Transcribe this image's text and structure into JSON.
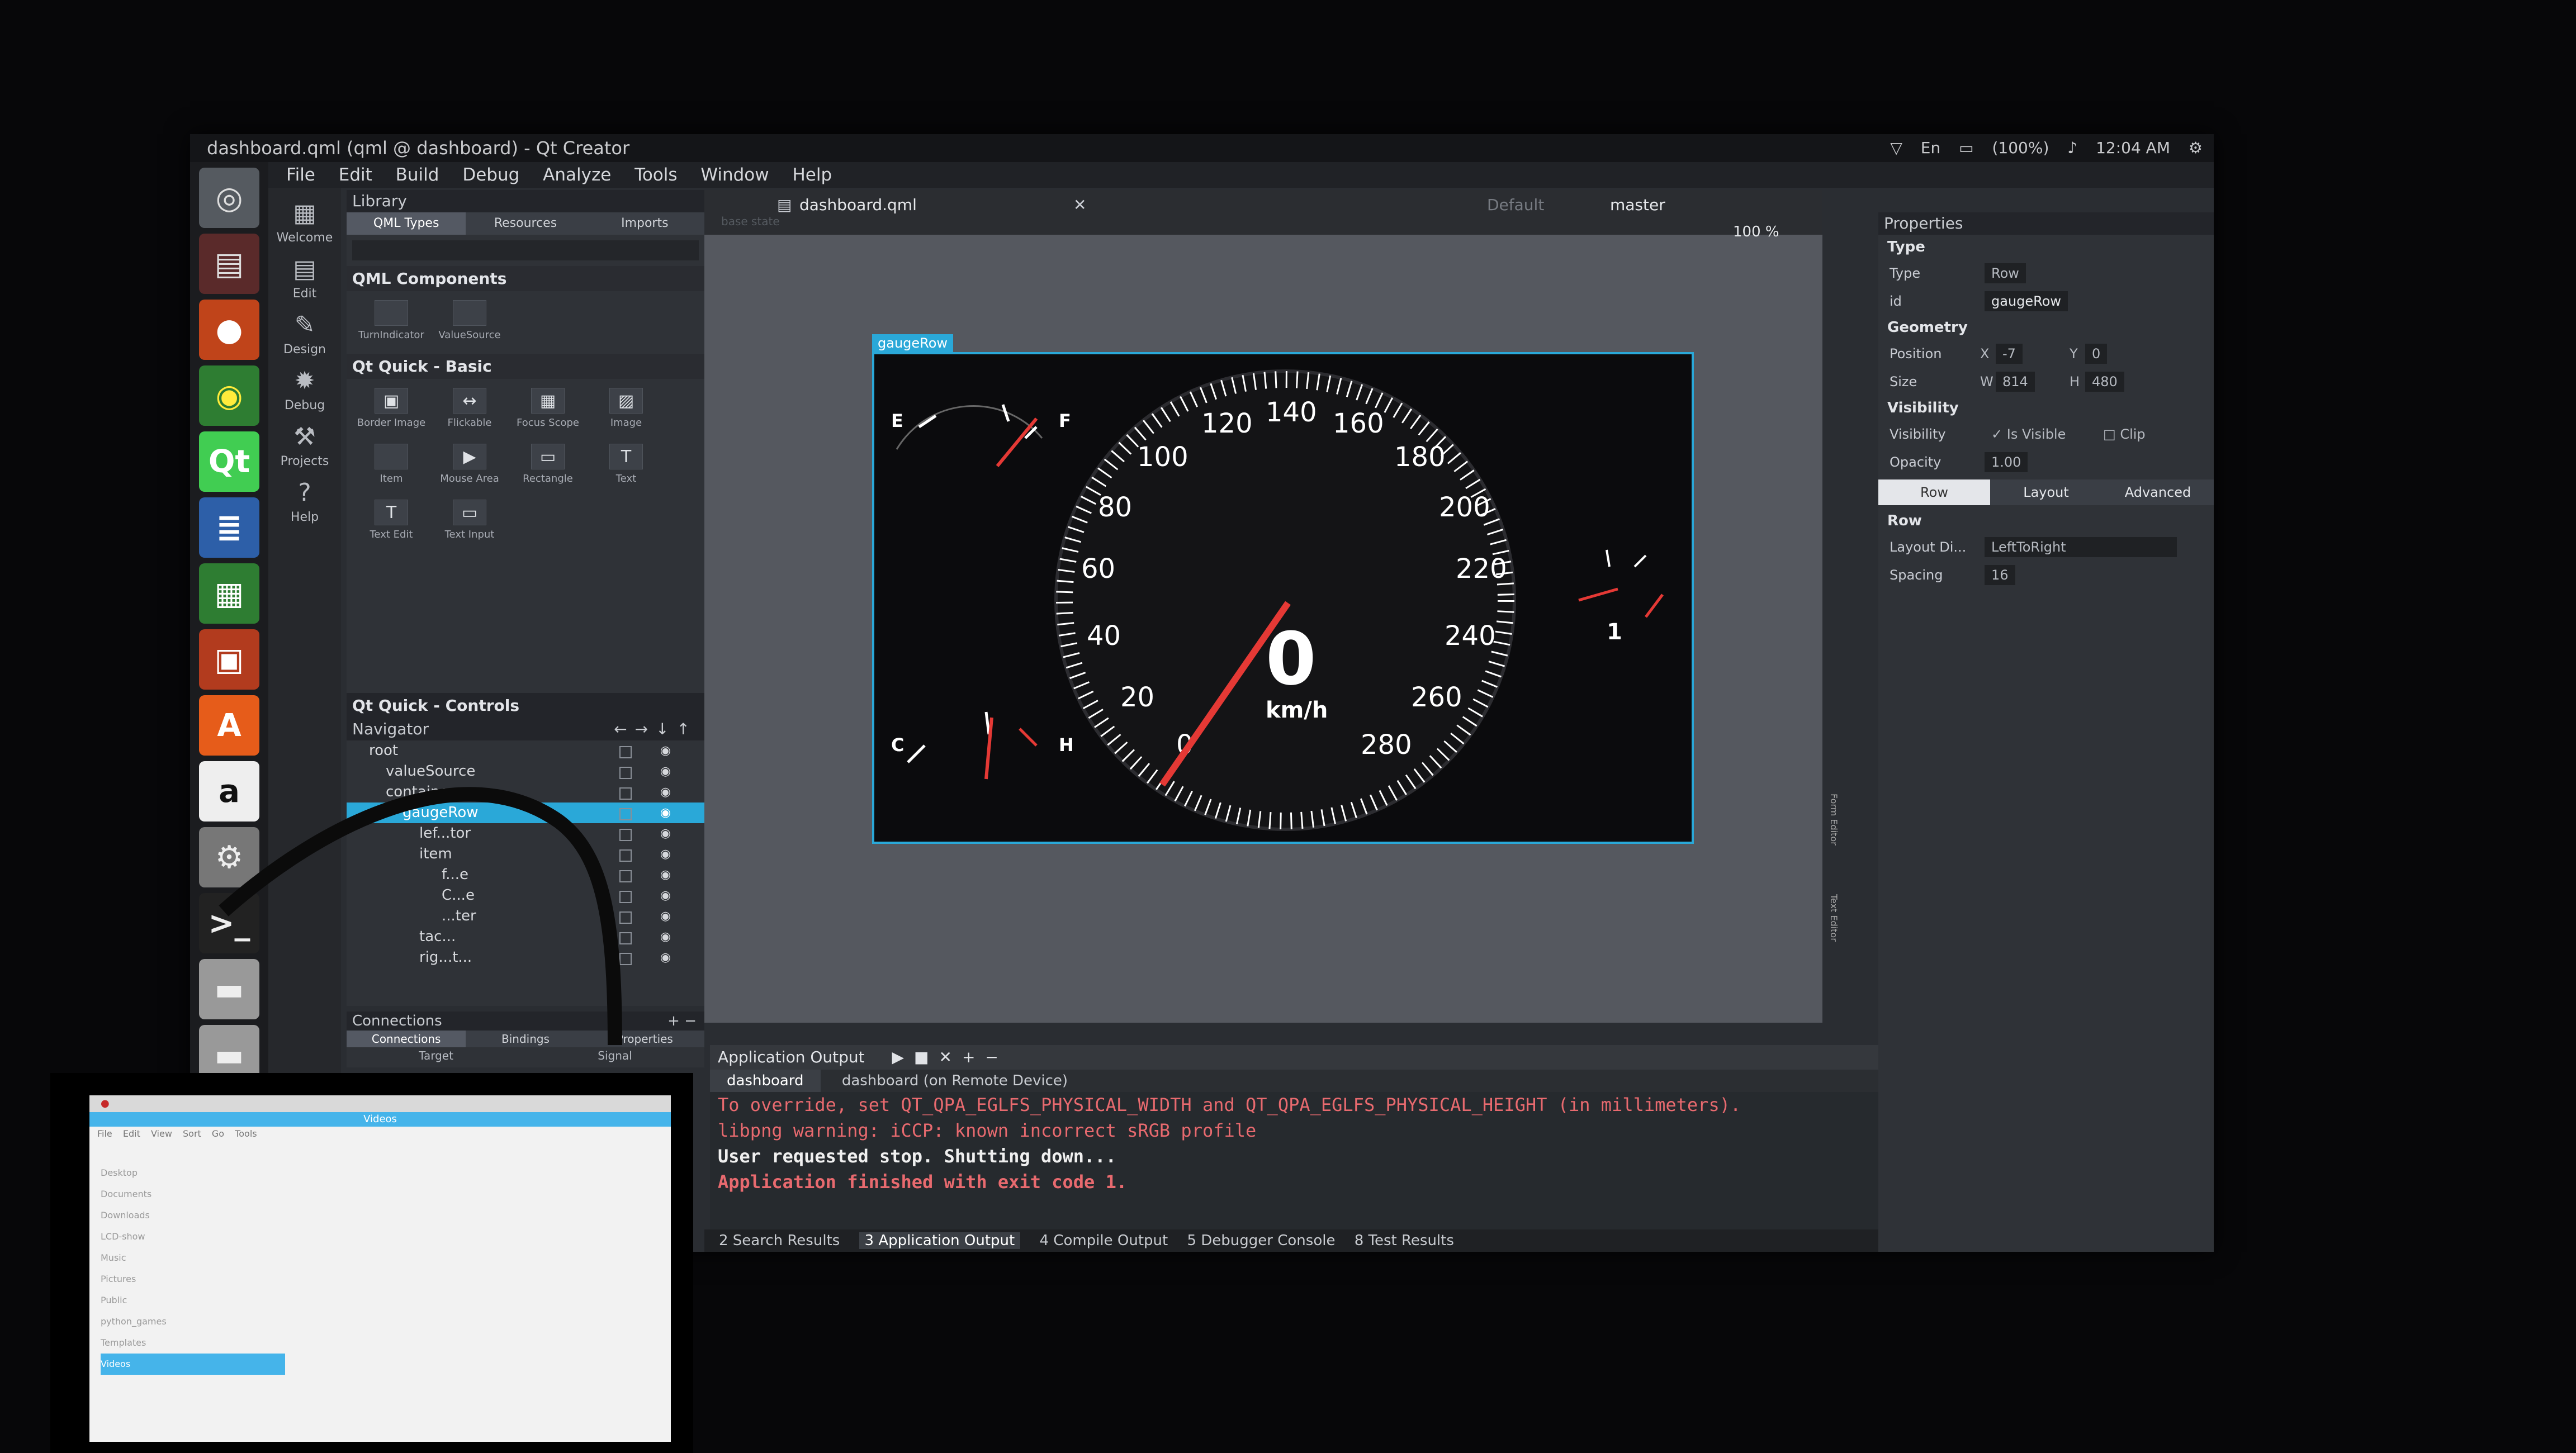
{
  "window": {
    "title": "dashboard.qml (qml @ dashboard) - Qt Creator",
    "status": {
      "keyboard": "En",
      "battery": "(100%)",
      "time": "12:04 AM"
    }
  },
  "menu": [
    "File",
    "Edit",
    "Build",
    "Debug",
    "Analyze",
    "Tools",
    "Window",
    "Help"
  ],
  "modes": [
    "Welcome",
    "Edit",
    "Design",
    "Debug",
    "Projects",
    "Help"
  ],
  "library": {
    "title": "Library",
    "tabs": [
      "QML Types",
      "Resources",
      "Imports"
    ],
    "sections": {
      "qml_components": "QML Components",
      "qml_components_items": [
        "TurnIndicator",
        "ValueSource"
      ],
      "qt_quick_basic": "Qt Quick - Basic",
      "qt_quick_basic_items": [
        "Border Image",
        "Flickable",
        "Focus Scope",
        "Image",
        "Item",
        "Mouse Area",
        "Rectangle",
        "Text",
        "Text Edit",
        "Text Input"
      ],
      "qt_quick_controls": "Qt Quick - Controls"
    }
  },
  "navigator": {
    "title": "Navigator",
    "rows": [
      "root",
      "valueSource",
      "container",
      "gaugeRow",
      "lef...tor",
      "item",
      "f...e",
      "C...e",
      "...ter",
      "tac...",
      "rig...t..."
    ]
  },
  "connections": {
    "title": "Connections",
    "tabs": [
      "Connections",
      "Bindings",
      "Properties"
    ],
    "columns": [
      "Target",
      "Signal"
    ]
  },
  "editor": {
    "file": "dashboard.qml",
    "default_state": "Default",
    "branch": "master",
    "zoom": "100 %",
    "state_button": "base state"
  },
  "dashboard": {
    "selection_label": "gaugeRow",
    "speed_value": "0",
    "speed_unit": "km/h",
    "speed_ticks": [
      "0",
      "20",
      "40",
      "60",
      "80",
      "100",
      "120",
      "140",
      "160",
      "180",
      "200",
      "220",
      "240",
      "260",
      "280"
    ],
    "fuel_labels": [
      "E",
      "F"
    ],
    "temp_labels": [
      "C",
      "H"
    ],
    "tacho_value": "1"
  },
  "side_labels": [
    "Form Editor",
    "Text Editor"
  ],
  "output": {
    "title": "Application Output",
    "tabs": [
      "dashboard",
      "dashboard (on Remote Device)"
    ],
    "lines": [
      "To override, set QT_QPA_EGLFS_PHYSICAL_WIDTH and QT_QPA_EGLFS_PHYSICAL_HEIGHT (in millimeters).",
      "libpng warning: iCCP: known incorrect sRGB profile",
      "User requested stop. Shutting down...",
      "Application finished with exit code 1."
    ],
    "line_colors": [
      "#e86a6f",
      "#e86a6f",
      "#f0f0f0",
      "#e86a6f"
    ]
  },
  "bottom_tabs": [
    "2 Search Results",
    "3 Application Output",
    "4 Compile Output",
    "5 Debugger Console",
    "8 Test Results"
  ],
  "properties": {
    "title": "Properties",
    "type_section": "Type",
    "type_label": "Type",
    "type_value": "Row",
    "id_label": "id",
    "id_value": "gaugeRow",
    "geometry_section": "Geometry",
    "position_label": "Position",
    "x_label": "X",
    "x_value": "-7",
    "y_label": "Y",
    "y_value": "0",
    "size_label": "Size",
    "w_label": "W",
    "w_value": "814",
    "h_label": "H",
    "h_value": "480",
    "visibility_section": "Visibility",
    "visibility_label": "Visibility",
    "is_visible": "Is Visible",
    "clip": "Clip",
    "opacity_label": "Opacity",
    "opacity_value": "1.00",
    "tabs": [
      "Row",
      "Layout",
      "Advanced"
    ],
    "row_section": "Row",
    "layout_dir_label": "Layout Di...",
    "layout_dir_value": "LeftToRight",
    "spacing_label": "Spacing",
    "spacing_value": "16"
  },
  "pi_screen": {
    "window_title": "Videos",
    "menu": [
      "File",
      "Edit",
      "View",
      "Sort",
      "Go",
      "Tools"
    ],
    "folders": [
      "Desktop",
      "Documents",
      "Downloads",
      "LCD-show",
      "Music",
      "Pictures",
      "Public",
      "python_games",
      "Templates",
      "Videos"
    ]
  }
}
